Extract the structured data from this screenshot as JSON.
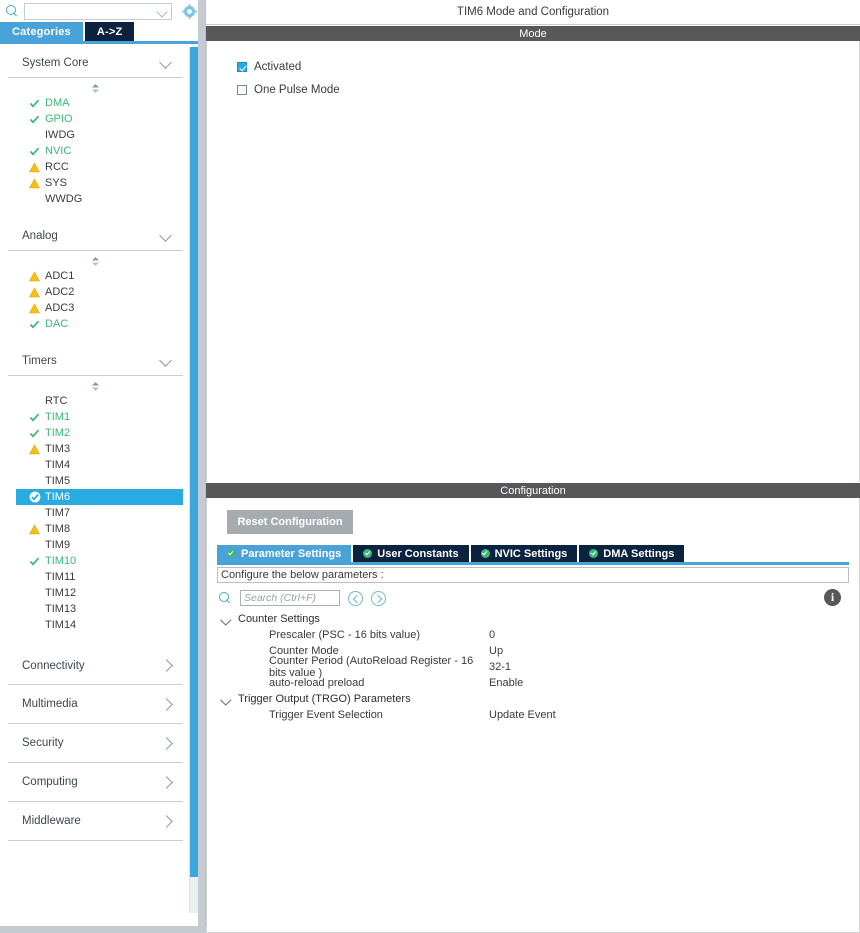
{
  "sidebar": {
    "search": {
      "value": "",
      "icon": "search-icon",
      "dropdown_icon": "chevron-down-icon"
    },
    "settings_icon": "gear-icon",
    "view_tabs": [
      {
        "label": "Categories",
        "active": true
      },
      {
        "label": "A->Z",
        "active": false
      }
    ],
    "categories": [
      {
        "label": "System Core",
        "expanded": true,
        "items": [
          {
            "label": "DMA",
            "status": "ok"
          },
          {
            "label": "GPIO",
            "status": "ok"
          },
          {
            "label": "IWDG",
            "status": "none"
          },
          {
            "label": "NVIC",
            "status": "ok"
          },
          {
            "label": "RCC",
            "status": "warning"
          },
          {
            "label": "SYS",
            "status": "warning"
          },
          {
            "label": "WWDG",
            "status": "none"
          }
        ]
      },
      {
        "label": "Analog",
        "expanded": true,
        "items": [
          {
            "label": "ADC1",
            "status": "warning"
          },
          {
            "label": "ADC2",
            "status": "warning"
          },
          {
            "label": "ADC3",
            "status": "warning"
          },
          {
            "label": "DAC",
            "status": "ok"
          }
        ]
      },
      {
        "label": "Timers",
        "expanded": true,
        "items": [
          {
            "label": "RTC",
            "status": "none"
          },
          {
            "label": "TIM1",
            "status": "ok"
          },
          {
            "label": "TIM2",
            "status": "ok"
          },
          {
            "label": "TIM3",
            "status": "warning"
          },
          {
            "label": "TIM4",
            "status": "none"
          },
          {
            "label": "TIM5",
            "status": "none"
          },
          {
            "label": "TIM6",
            "status": "selected"
          },
          {
            "label": "TIM7",
            "status": "none"
          },
          {
            "label": "TIM8",
            "status": "warning"
          },
          {
            "label": "TIM9",
            "status": "none"
          },
          {
            "label": "TIM10",
            "status": "ok"
          },
          {
            "label": "TIM11",
            "status": "none"
          },
          {
            "label": "TIM12",
            "status": "none"
          },
          {
            "label": "TIM13",
            "status": "none"
          },
          {
            "label": "TIM14",
            "status": "none"
          }
        ]
      },
      {
        "label": "Connectivity",
        "expanded": false,
        "items": []
      },
      {
        "label": "Multimedia",
        "expanded": false,
        "items": []
      },
      {
        "label": "Security",
        "expanded": false,
        "items": []
      },
      {
        "label": "Computing",
        "expanded": false,
        "items": []
      },
      {
        "label": "Middleware",
        "expanded": false,
        "items": []
      }
    ]
  },
  "main": {
    "title": "TIM6 Mode and Configuration",
    "mode": {
      "section_label": "Mode",
      "checkboxes": [
        {
          "label": "Activated",
          "checked": true
        },
        {
          "label": "One Pulse Mode",
          "checked": false
        }
      ]
    },
    "configuration": {
      "section_label": "Configuration",
      "reset_label": "Reset Configuration",
      "tabs": [
        {
          "label": "Parameter Settings",
          "active": true,
          "icon": "check-circle-icon"
        },
        {
          "label": "User Constants",
          "active": false,
          "icon": "check-circle-icon"
        },
        {
          "label": "NVIC Settings",
          "active": false,
          "icon": "check-circle-icon"
        },
        {
          "label": "DMA Settings",
          "active": false,
          "icon": "check-circle-icon"
        }
      ],
      "hint": "Configure the below parameters :",
      "search_placeholder": "Search (Ctrl+F)",
      "search_value": "",
      "prev_icon": "chevron-left-circle-icon",
      "next_icon": "chevron-right-circle-icon",
      "info_icon": "info-icon",
      "groups": [
        {
          "label": "Counter Settings",
          "expanded": true,
          "params": [
            {
              "name": "Prescaler (PSC - 16 bits value)",
              "value": "0"
            },
            {
              "name": "Counter Mode",
              "value": "Up"
            },
            {
              "name": "Counter Period (AutoReload Register - 16 bits value )",
              "value": "32-1"
            },
            {
              "name": "auto-reload preload",
              "value": "Enable"
            }
          ]
        },
        {
          "label": "Trigger Output (TRGO) Parameters",
          "expanded": true,
          "params": [
            {
              "name": "Trigger Event Selection",
              "value": "Update Event"
            }
          ]
        }
      ]
    }
  },
  "colors": {
    "accent": "#29abe2",
    "tab_active": "#4aa3d8",
    "tab_inactive": "#0c2340",
    "section_bar": "#58585a",
    "ok": "#3cb878",
    "warning": "#f5bf1a"
  }
}
